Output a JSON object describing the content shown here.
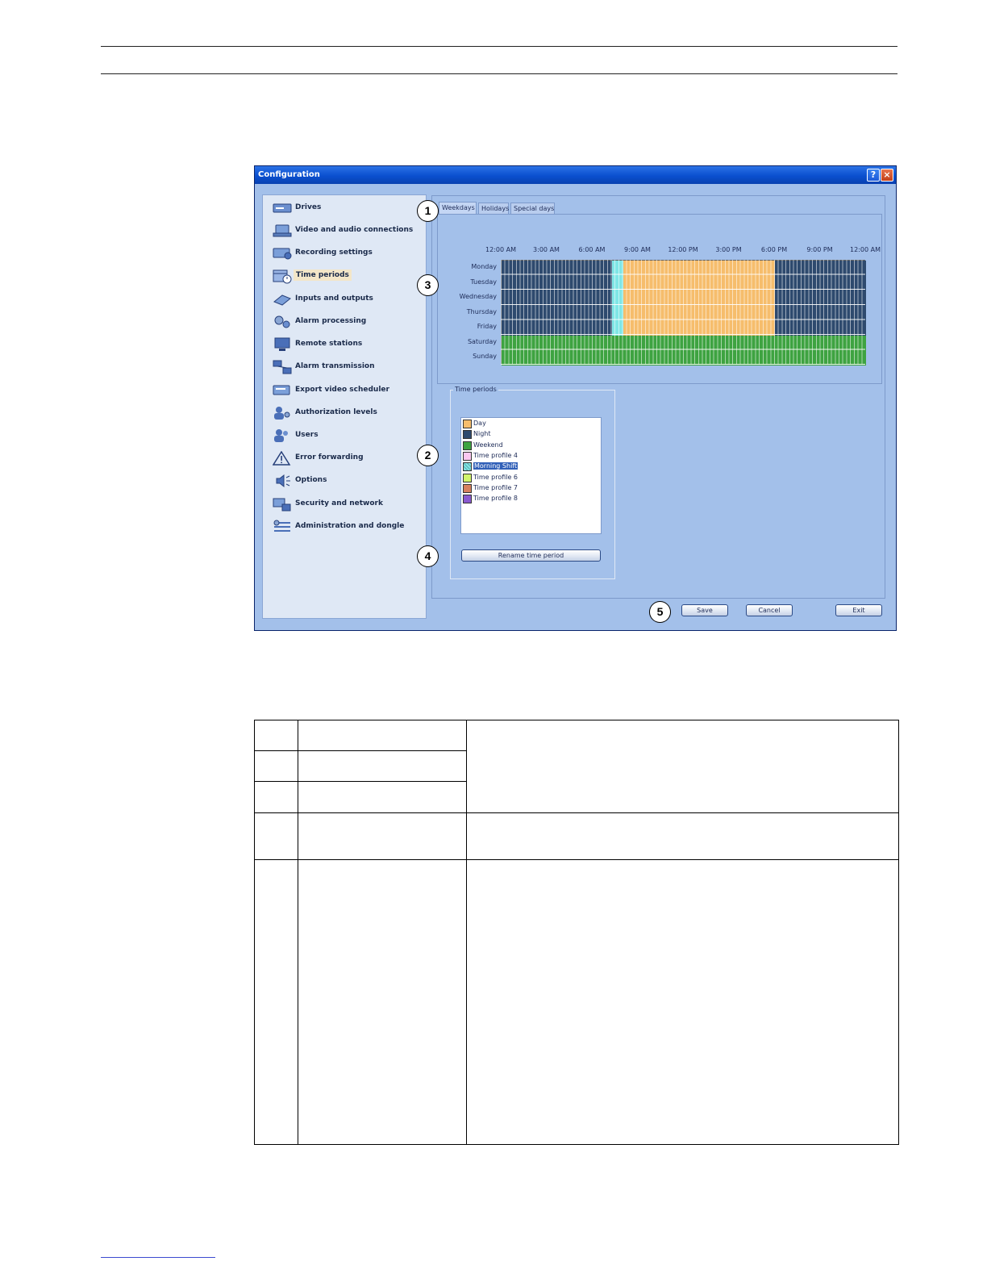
{
  "window": {
    "title": "Configuration",
    "help_glyph": "?",
    "close_glyph": "×"
  },
  "nav": {
    "items": [
      {
        "label": "Drives",
        "icon": "drive-icon"
      },
      {
        "label": "Video and audio connections",
        "icon": "video-connection-icon"
      },
      {
        "label": "Recording settings",
        "icon": "recording-icon"
      },
      {
        "label": "Time periods",
        "icon": "calendar-clock-icon",
        "selected": true
      },
      {
        "label": "Inputs and outputs",
        "icon": "io-icon"
      },
      {
        "label": "Alarm processing",
        "icon": "gears-icon"
      },
      {
        "label": "Remote stations",
        "icon": "monitor-icon"
      },
      {
        "label": "Alarm transmission",
        "icon": "network-icon"
      },
      {
        "label": "Export video scheduler",
        "icon": "export-icon"
      },
      {
        "label": "Authorization levels",
        "icon": "users-key-icon"
      },
      {
        "label": "Users",
        "icon": "users-icon"
      },
      {
        "label": "Error forwarding",
        "icon": "warning-icon"
      },
      {
        "label": "Options",
        "icon": "speaker-icon"
      },
      {
        "label": "Security and network",
        "icon": "lock-icon"
      },
      {
        "label": "Administration and dongle",
        "icon": "wrench-icon"
      }
    ]
  },
  "tabs": [
    "Weekdays",
    "Holidays",
    "Special days"
  ],
  "schedule": {
    "time_labels": [
      "12:00 AM",
      "3:00 AM",
      "6:00 AM",
      "9:00 AM",
      "12:00 PM",
      "3:00 PM",
      "6:00 PM",
      "9:00 PM",
      "12:00 AM"
    ],
    "days": [
      "Monday",
      "Tuesday",
      "Wednesday",
      "Thursday",
      "Friday",
      "Saturday",
      "Sunday"
    ],
    "weekday_blocks": [
      {
        "from_hour": 0,
        "to_hour": 7.25,
        "period": "Night"
      },
      {
        "from_hour": 7.25,
        "to_hour": 8.0,
        "period": "Morning Shift"
      },
      {
        "from_hour": 8.0,
        "to_hour": 18.0,
        "period": "Day"
      },
      {
        "from_hour": 18.0,
        "to_hour": 24,
        "period": "Night"
      }
    ],
    "weekend_period": "Weekend"
  },
  "time_periods": {
    "group_title": "Time periods",
    "items": [
      {
        "label": "Day",
        "color": "#f6bd6c"
      },
      {
        "label": "Night",
        "color": "#2e4a6e"
      },
      {
        "label": "Weekend",
        "color": "#3ea341"
      },
      {
        "label": "Time profile 4",
        "color": "#fbc8f0"
      },
      {
        "label": "Morning Shift",
        "color": "#7fe6e6",
        "selected": true
      },
      {
        "label": "Time profile 6",
        "color": "#d2f46c"
      },
      {
        "label": "Time profile 7",
        "color": "#d88060"
      },
      {
        "label": "Time profile 8",
        "color": "#8a5ad0"
      }
    ],
    "rename_button": "Rename time period"
  },
  "buttons": {
    "save": "Save",
    "cancel": "Cancel",
    "exit": "Exit"
  },
  "callouts": [
    "1",
    "2",
    "3",
    "4",
    "5"
  ],
  "colors": {
    "night": "#2e4a6e",
    "day": "#f6bd6c",
    "morning": "#7fe6e6",
    "weekend": "#3ea341"
  }
}
